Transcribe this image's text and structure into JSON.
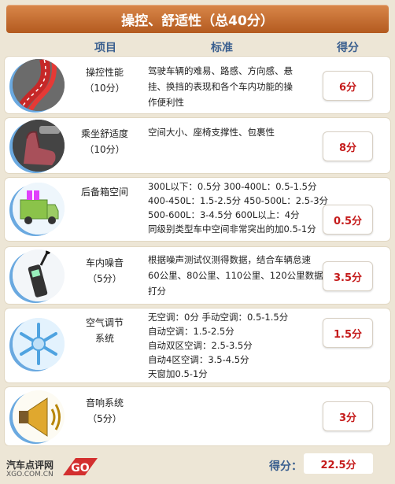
{
  "header": {
    "title": "操控、舒适性（总40分）"
  },
  "columns": {
    "item": "项目",
    "standard": "标准",
    "score": "得分"
  },
  "rows": [
    {
      "item_lines": [
        "操控性能",
        "（10分）"
      ],
      "standard_lines": [
        "驾驶车辆的难易、路感、方向感、悬",
        "挂、换挡的表现和各个车内功能的操",
        "作便利性"
      ],
      "score": "6分",
      "icon": "road-curve-icon"
    },
    {
      "item_lines": [
        "乘坐舒适度",
        "（10分）"
      ],
      "standard_lines": [
        "空间大小、座椅支撑性、包裹性"
      ],
      "score": "8分",
      "icon": "car-seat-icon"
    },
    {
      "item_lines": [
        "后备箱空间",
        ""
      ],
      "standard_lines": [
        "300L以下：0.5分   300-400L：0.5-1.5分",
        "400-450L：1.5-2.5分 450-500L：2.5-3分",
        "500-600L：3-4.5分  600L以上：4分",
        "同级别类型车中空间非常突出的加0.5-1分"
      ],
      "score": "0.5分",
      "icon": "cargo-truck-icon"
    },
    {
      "item_lines": [
        "车内噪音",
        "（5分）"
      ],
      "standard_lines": [
        "根据噪声测试仪测得数据，结合车辆怠速",
        "60公里、80公里、110公里、120公里数据",
        "打分"
      ],
      "score": "3.5分",
      "icon": "sound-meter-icon"
    },
    {
      "item_lines": [
        "空气调节",
        "系统"
      ],
      "standard_lines": [
        "无空调：0分 手动空调：0.5-1.5分",
        "自动空调：1.5-2.5分",
        "自动双区空调：2.5-3.5分",
        "自动4区空调：3.5-4.5分",
        "天窗加0.5-1分"
      ],
      "score": "1.5分",
      "icon": "snowflake-icon"
    },
    {
      "item_lines": [
        "音响系统",
        "（5分）"
      ],
      "standard_lines": [],
      "score": "3分",
      "icon": "speaker-icon"
    }
  ],
  "footer": {
    "logo_text": "汽车点评网",
    "logo_url": "XGO.COM.CN",
    "logo_badge": "GO",
    "total_label": "得分：",
    "total_value": "22.5分"
  }
}
